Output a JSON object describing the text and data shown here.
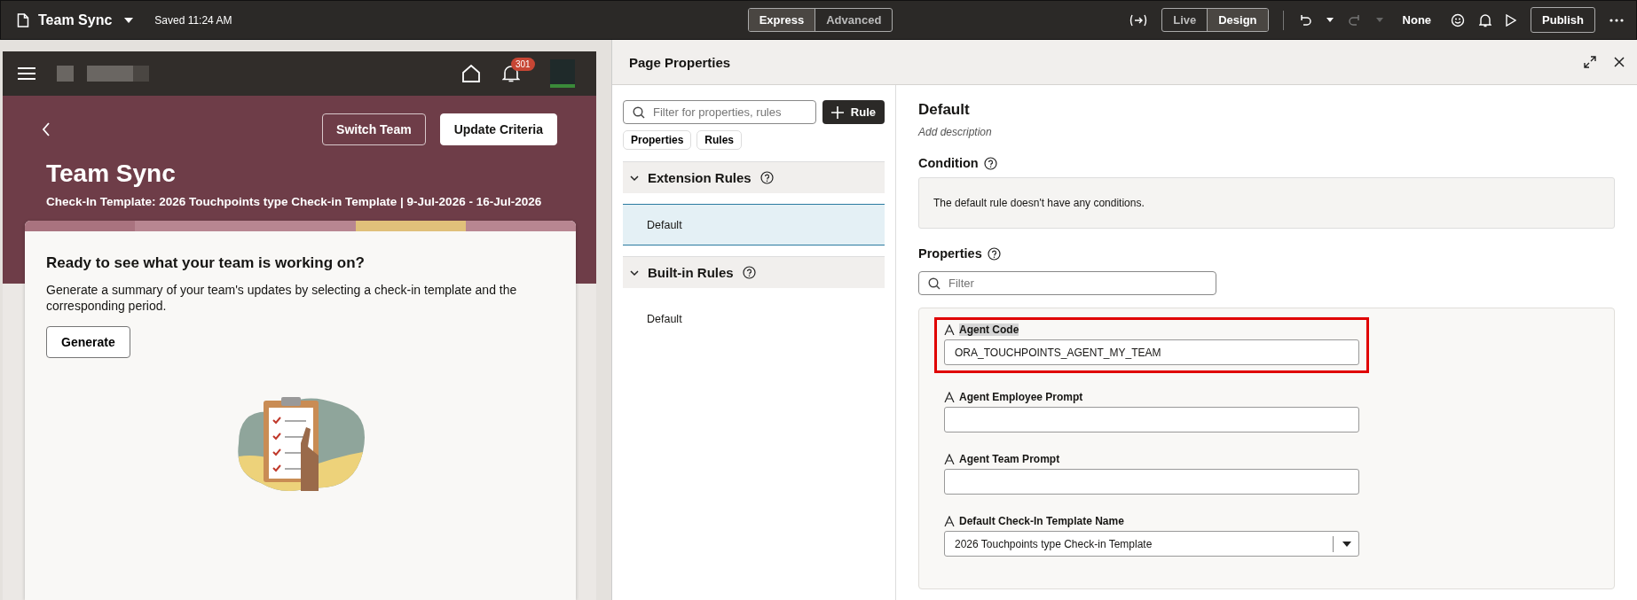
{
  "topbar": {
    "title": "Team Sync",
    "saved": "Saved 11:24 AM",
    "mode_tabs": [
      {
        "label": "Express",
        "selected": true
      },
      {
        "label": "Advanced",
        "selected": false
      }
    ],
    "view_tabs": [
      {
        "label": "Live",
        "selected": false
      },
      {
        "label": "Design",
        "selected": true
      }
    ],
    "audience": "None",
    "publish": "Publish"
  },
  "preview": {
    "badge": "301",
    "header_buttons": [
      {
        "label": "Switch Team",
        "kind": "outline"
      },
      {
        "label": "Update Criteria",
        "kind": "solid"
      }
    ],
    "title": "Team Sync",
    "subtitle": "Check-In Template: 2026 Touchpoints type Check-in Template | 9-Jul-2026 - 16-Jul-2026",
    "card": {
      "heading": "Ready to see what your team is working on?",
      "body": "Generate a summary of your team's updates by selecting a check-in template and the corresponding period.",
      "button": "Generate"
    }
  },
  "panel": {
    "title": "Page Properties",
    "filter_placeholder": "Filter for properties, rules",
    "add_rule": "Rule",
    "chips": [
      "Properties",
      "Rules"
    ],
    "sections": [
      {
        "title": "Extension Rules",
        "expanded": true,
        "rules": [
          {
            "label": "Default",
            "selected": true
          }
        ]
      },
      {
        "title": "Built-in Rules",
        "expanded": true,
        "rules": [
          {
            "label": "Default",
            "selected": false
          }
        ]
      }
    ]
  },
  "detail": {
    "title": "Default",
    "description": "Add description",
    "condition_heading": "Condition",
    "condition_text": "The default rule doesn't have any conditions.",
    "properties_heading": "Properties",
    "filter_placeholder": "Filter",
    "properties": [
      {
        "label": "Agent Code",
        "kind": "text",
        "value": "ORA_TOUCHPOINTS_AGENT_MY_TEAM",
        "highlighted": true
      },
      {
        "label": "Agent Employee Prompt",
        "kind": "text",
        "highlighted": false
      },
      {
        "label": "Agent Team Prompt",
        "kind": "text",
        "highlighted": false
      },
      {
        "label": "Default Check-In Template Name",
        "kind": "select",
        "value": "2026 Touchpoints type Check-in Template",
        "highlighted": false
      }
    ]
  }
}
